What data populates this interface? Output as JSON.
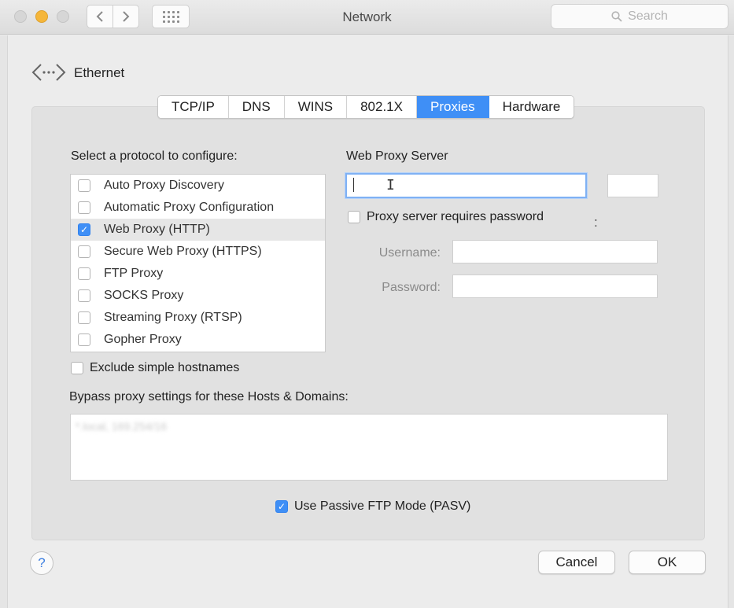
{
  "window": {
    "title": "Network"
  },
  "toolbar": {
    "back_icon": "chevron-left-icon",
    "forward_icon": "chevron-right-icon",
    "grid_icon": "show-all-grid-icon",
    "search_placeholder": "Search"
  },
  "interface": {
    "name": "Ethernet",
    "icon": "ethernet-icon"
  },
  "tabs": [
    {
      "label": "TCP/IP",
      "active": false
    },
    {
      "label": "DNS",
      "active": false
    },
    {
      "label": "WINS",
      "active": false
    },
    {
      "label": "802.1X",
      "active": false
    },
    {
      "label": "Proxies",
      "active": true
    },
    {
      "label": "Hardware",
      "active": false
    }
  ],
  "protocols": {
    "heading": "Select a protocol to configure:",
    "items": [
      {
        "label": "Auto Proxy Discovery",
        "checked": false
      },
      {
        "label": "Automatic Proxy Configuration",
        "checked": false
      },
      {
        "label": "Web Proxy (HTTP)",
        "checked": true,
        "selected": true
      },
      {
        "label": "Secure Web Proxy (HTTPS)",
        "checked": false
      },
      {
        "label": "FTP Proxy",
        "checked": false
      },
      {
        "label": "SOCKS Proxy",
        "checked": false
      },
      {
        "label": "Streaming Proxy (RTSP)",
        "checked": false
      },
      {
        "label": "Gopher Proxy",
        "checked": false
      }
    ]
  },
  "server": {
    "heading": "Web Proxy Server",
    "address_value": "",
    "separator": ":",
    "port_value": "",
    "requires_password_label": "Proxy server requires password",
    "requires_password": false,
    "username_label": "Username:",
    "username_value": "",
    "password_label": "Password:",
    "password_value": ""
  },
  "exclude_simple": {
    "label": "Exclude simple hostnames",
    "checked": false
  },
  "bypass": {
    "heading": "Bypass proxy settings for these Hosts & Domains:",
    "value": "*.local, 169.254/16"
  },
  "passive_ftp": {
    "label": "Use Passive FTP Mode (PASV)",
    "checked": true
  },
  "buttons": {
    "help": "?",
    "cancel": "Cancel",
    "ok": "OK"
  },
  "colors": {
    "accent": "#3f8ff6",
    "focus_ring": "#7fb1f4",
    "traffic_yellow": "#f5b63a"
  }
}
